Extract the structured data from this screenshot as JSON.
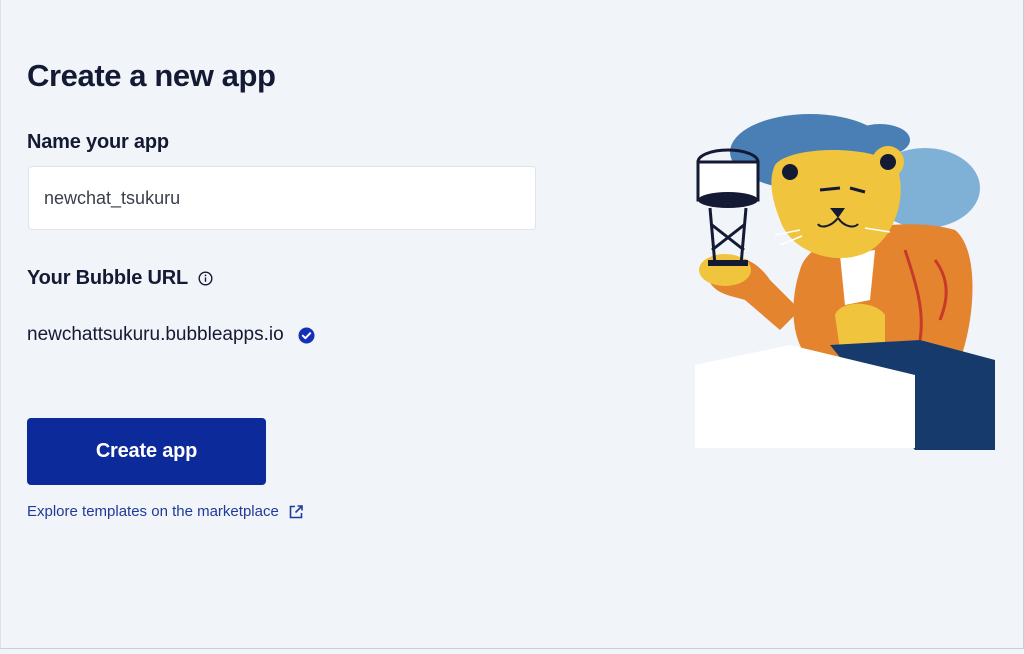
{
  "page": {
    "title": "Create a new app"
  },
  "name_field": {
    "label": "Name your app",
    "value": "newchat_tsukuru"
  },
  "url_section": {
    "label": "Your Bubble URL",
    "url": "newchattsukuru.bubbleapps.io",
    "info_icon": "info-circle-icon",
    "status_icon": "verified-check-icon"
  },
  "create_button": {
    "label": "Create app"
  },
  "explore_link": {
    "label": "Explore templates on the marketplace",
    "icon": "external-link-icon"
  },
  "illustration": {
    "subject": "lion-holding-water-tower-illustration"
  },
  "colors": {
    "background": "#f1f4f8",
    "primary_button": "#0c2a9a",
    "link": "#1f3a9a",
    "check": "#1530b5",
    "text": "#141a33"
  }
}
